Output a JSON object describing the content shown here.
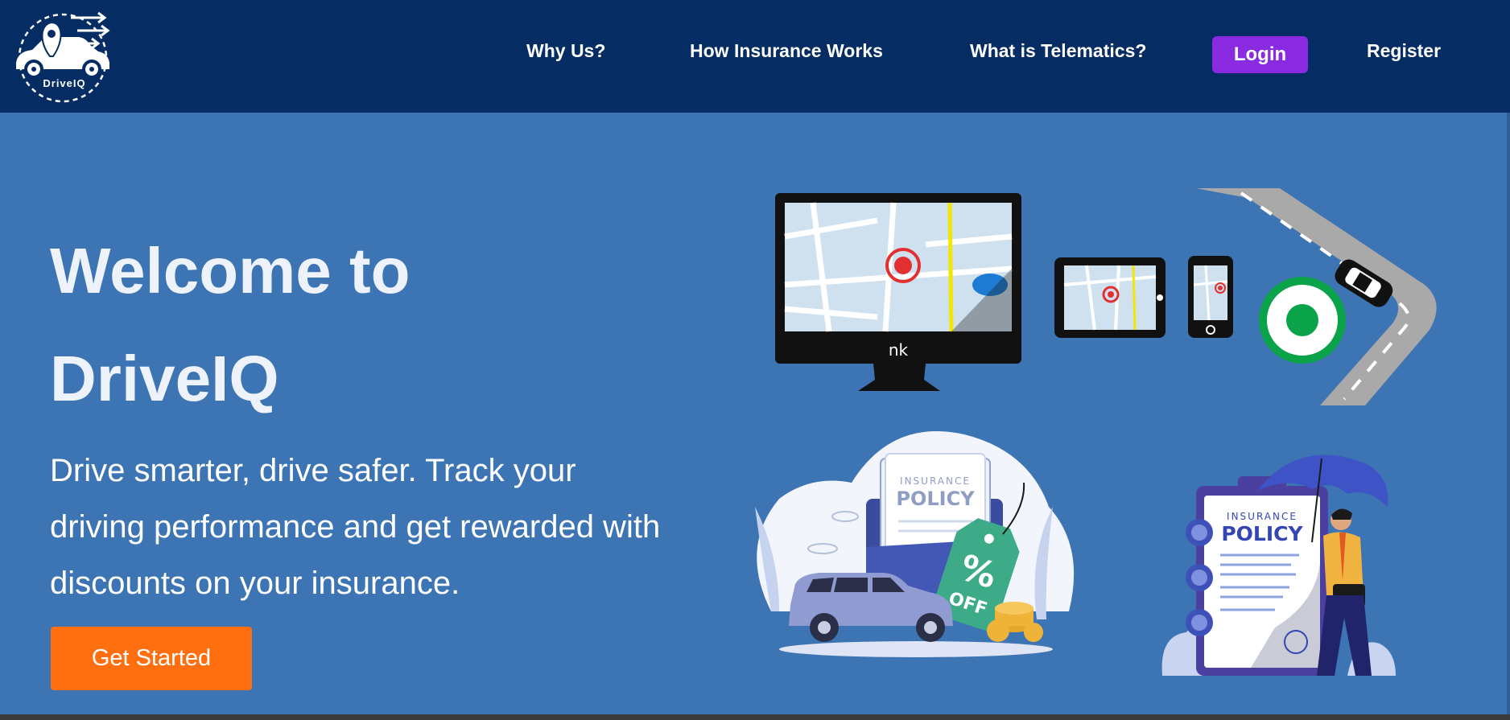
{
  "brand": {
    "logo_text": "DriveIQ"
  },
  "nav": {
    "links": [
      "Why Us?",
      "How Insurance Works",
      "What is Telematics?"
    ],
    "login_label": "Login",
    "register_label": "Register"
  },
  "hero": {
    "title_line1": "Welcome to",
    "title_line2": "DriveIQ",
    "subtitle": "Drive smarter, drive safer. Track your driving performance and get rewarded with discounts on your insurance.",
    "cta_label": "Get Started"
  },
  "illustrations": {
    "monitor_brand": "nk",
    "policy_card_1": {
      "small": "INSURANCE",
      "big": "POLICY",
      "tag_big": "%",
      "tag_small": "OFF"
    },
    "policy_card_2": {
      "small": "INSURANCE",
      "big": "POLICY"
    }
  },
  "colors": {
    "nav_bg": "#052d63",
    "hero_bg": "#3c74b4",
    "login_bg": "#8a2be2",
    "cta_bg": "#ff6f0f"
  }
}
